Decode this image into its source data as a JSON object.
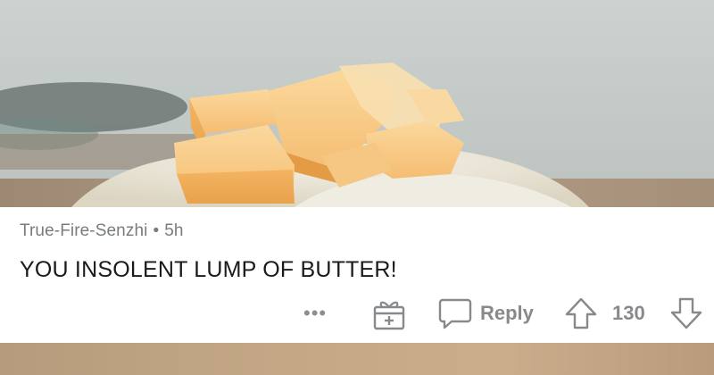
{
  "photo": {
    "subject": "butter cubes on flour",
    "colors": {
      "butter": "#f7c27a",
      "flour": "#ece8dc",
      "background": "#c5cbc8"
    }
  },
  "comment": {
    "username": "True-Fire-Senzhi",
    "separator": "•",
    "age": "5h",
    "text": "YOU INSOLENT LUMP OF BUTTER!"
  },
  "actions": {
    "more_label": "•••",
    "award_icon": "gift-icon",
    "reply_label": "Reply",
    "reply_icon": "speech-bubble-icon",
    "upvote_icon": "arrow-up-icon",
    "score": "130",
    "downvote_icon": "arrow-down-icon",
    "icon_color": "#878a8c"
  }
}
